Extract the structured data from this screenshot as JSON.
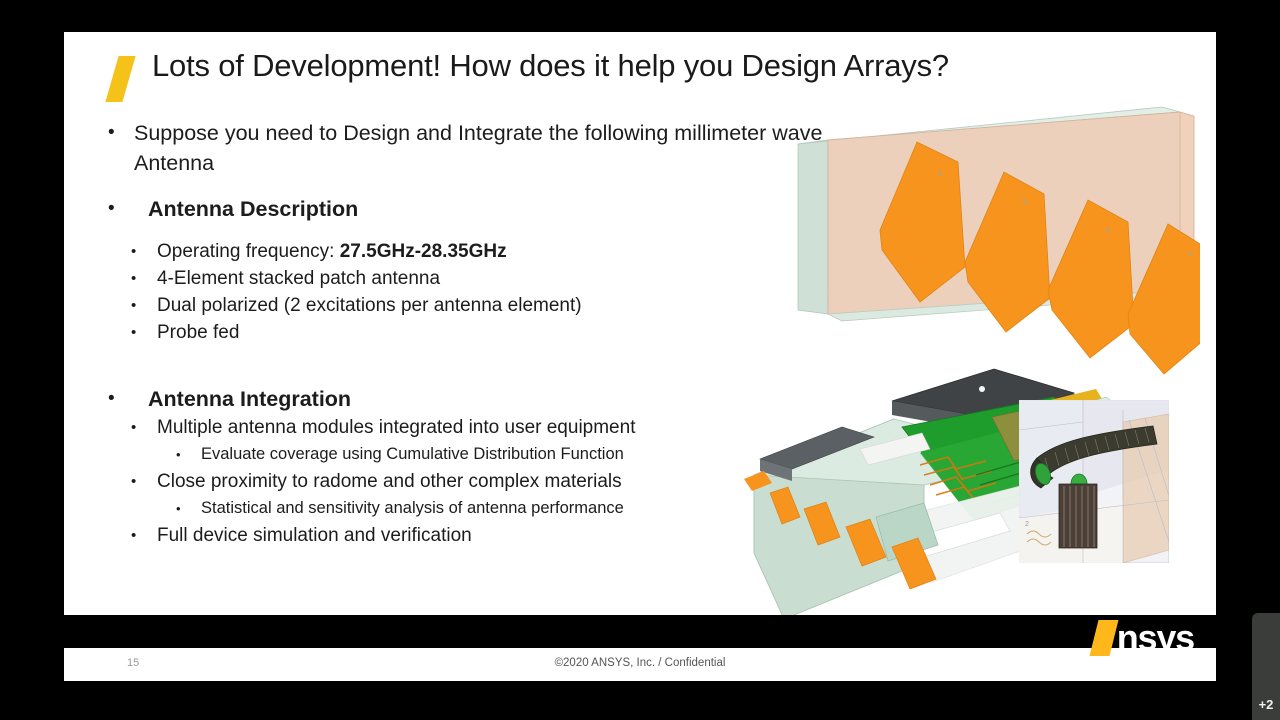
{
  "slide": {
    "title": "Lots of Development! How does it help you Design Arrays?",
    "bullets": {
      "intro": "Suppose you need to Design and Integrate the following millimeter wave Antenna",
      "section1_heading": "Antenna Description",
      "section1_items": [
        {
          "prefix": "Operating frequency: ",
          "bold": "27.5GHz-28.35GHz"
        },
        {
          "prefix": "4-Element stacked patch antenna",
          "bold": ""
        },
        {
          "prefix": "Dual polarized (2 excitations per antenna element)",
          "bold": ""
        },
        {
          "prefix": "Probe fed",
          "bold": ""
        }
      ],
      "section2_heading": "Antenna Integration",
      "section2_items": [
        "Multiple antenna modules integrated into user equipment",
        "Close proximity to radome and other complex materials",
        "Full device simulation and verification"
      ],
      "section2_sub1": "Evaluate coverage using Cumulative Distribution Function",
      "section2_sub2": "Statistical and sensitivity analysis of antenna performance"
    },
    "footer": {
      "page_number": "15",
      "copyright": "©2020 ANSYS, Inc. / Confidential",
      "logo_text": "nsys"
    },
    "bullet_glyph": "•",
    "colors": {
      "accent_yellow": "#f5c219",
      "logo_yellow": "#ffb71b",
      "patch_orange": "#f7941d",
      "substrate_tan": "#e8c4a8",
      "pcb_green": "#1f9d2c",
      "case_mint": "#c9ded0",
      "footer_black": "#000000"
    }
  },
  "overlay": {
    "participant_count": "+2"
  }
}
